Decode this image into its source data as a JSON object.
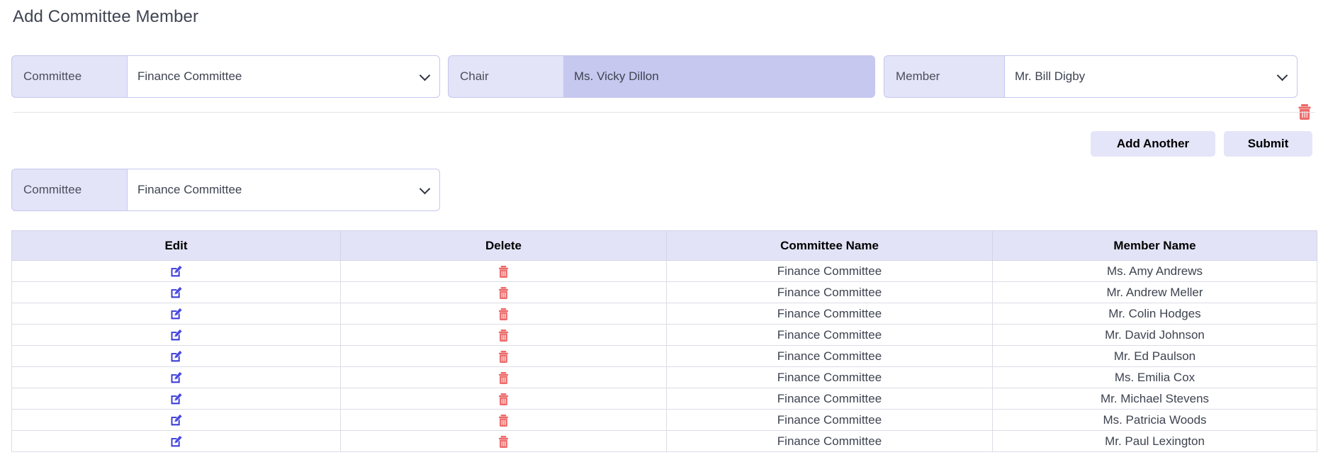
{
  "page": {
    "title": "Add Committee Member"
  },
  "form": {
    "committee": {
      "label": "Committee",
      "value": "Finance Committee",
      "icon": "chevron-down-icon"
    },
    "chair": {
      "label": "Chair",
      "value": "Ms. Vicky Dillon"
    },
    "member": {
      "label": "Member",
      "value": "Mr. Bill Digby",
      "icon": "chevron-down-icon"
    },
    "delete_row_icon": "trash-icon"
  },
  "actions": {
    "add_another_label": "Add Another",
    "submit_label": "Submit"
  },
  "filter": {
    "committee": {
      "label": "Committee",
      "value": "Finance Committee",
      "icon": "chevron-down-icon"
    }
  },
  "table": {
    "columns": [
      "Edit",
      "Delete",
      "Committee Name",
      "Member Name"
    ],
    "edit_icon": "edit-pencil-icon",
    "delete_icon": "trash-icon",
    "rows": [
      {
        "committee": "Finance Committee",
        "member": "Ms. Amy Andrews"
      },
      {
        "committee": "Finance Committee",
        "member": "Mr. Andrew Meller"
      },
      {
        "committee": "Finance Committee",
        "member": "Mr. Colin Hodges"
      },
      {
        "committee": "Finance Committee",
        "member": "Mr. David Johnson"
      },
      {
        "committee": "Finance Committee",
        "member": "Mr. Ed Paulson"
      },
      {
        "committee": "Finance Committee",
        "member": "Ms. Emilia Cox"
      },
      {
        "committee": "Finance Committee",
        "member": "Mr. Michael Stevens"
      },
      {
        "committee": "Finance Committee",
        "member": "Ms. Patricia Woods"
      },
      {
        "committee": "Finance Committee",
        "member": "Mr. Paul Lexington"
      }
    ]
  },
  "colors": {
    "label_bg": "#e3e4f8",
    "readonly_bg": "#c7c8ef",
    "border": "#c5c7ee",
    "button_bg": "#e4e5f9",
    "header_bg": "#e2e3f7",
    "edit_icon": "#3b3ad8",
    "delete_icon": "#ed6a6a",
    "title_text": "#3f4552"
  }
}
